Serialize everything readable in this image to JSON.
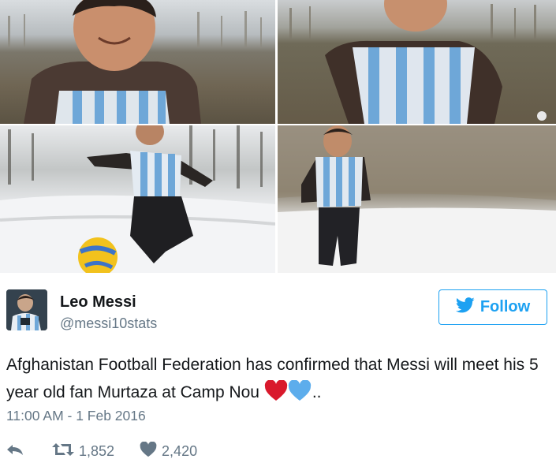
{
  "tweet": {
    "author_name": "Leo Messi",
    "author_handle": "@messi10stats",
    "follow_label": "Follow",
    "text": "Afghanistan Football Federation has confirmed that Messi will meet his 5 year old fan Murtaza at Camp Nou",
    "text_suffix": "..",
    "emoji": [
      "red-heart",
      "blue-heart"
    ],
    "timestamp": "11:00 AM - 1 Feb 2016",
    "retweet_count": "1,852",
    "like_count": "2,420"
  },
  "media": {
    "photo_count": 4
  },
  "colors": {
    "accent": "#1da1f2",
    "secondary_text": "#657786",
    "primary_text": "#14171a",
    "heart_red": "#e0245e",
    "heart_blue": "#5dadec"
  }
}
